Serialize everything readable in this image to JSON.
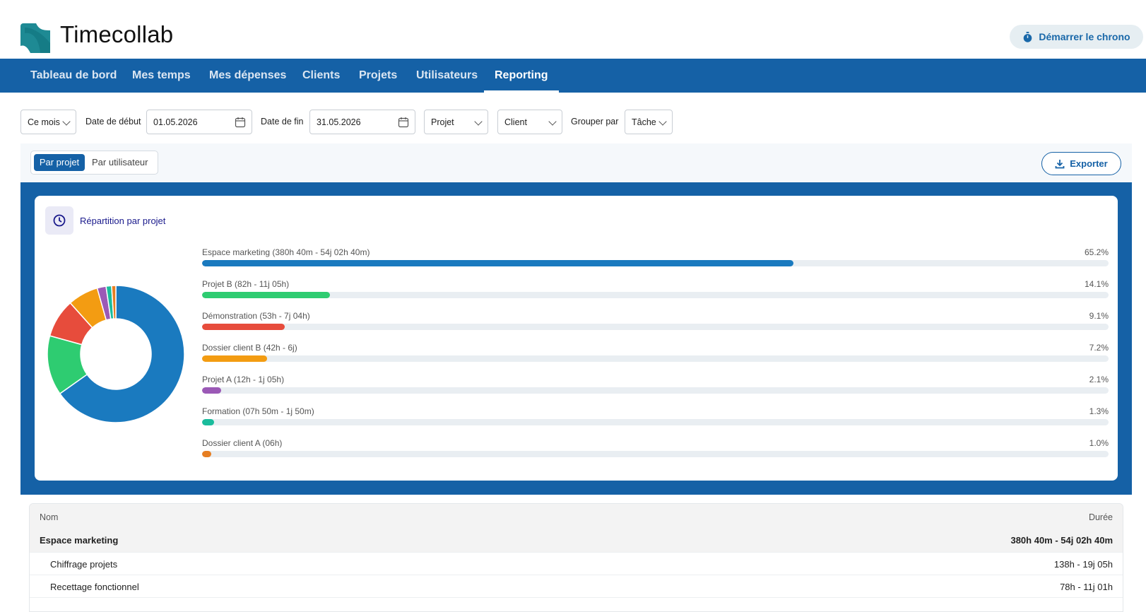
{
  "app": {
    "title": "Timecollab",
    "chrono_label": "Démarrer le chrono"
  },
  "nav": {
    "items": [
      {
        "label": "Tableau de bord"
      },
      {
        "label": "Mes temps"
      },
      {
        "label": "Mes dépenses"
      },
      {
        "label": "Clients"
      },
      {
        "label": "Projets"
      },
      {
        "label": "Utilisateurs"
      },
      {
        "label": "Reporting",
        "active": true
      }
    ]
  },
  "filters": {
    "period": "Ce mois",
    "start_label": "Date de début",
    "start_date": "01.05.2026",
    "end_label": "Date de fin",
    "end_date": "31.05.2026",
    "project": "Projet",
    "client": "Client",
    "group_label": "Grouper par",
    "group_value": "Tâche"
  },
  "view": {
    "by_project": "Par projet",
    "by_user": "Par utilisateur",
    "export_label": "Exporter"
  },
  "chart_card": {
    "title": "Répartition par projet"
  },
  "chart_data": {
    "type": "pie",
    "donut": true,
    "series": [
      {
        "label": "Espace marketing (380h 40m - 54j 02h 40m)",
        "pct_label": "65.2%",
        "value": 65.2,
        "color": "#1a7abf"
      },
      {
        "label": "Projet B (82h - 11j 05h)",
        "pct_label": "14.1%",
        "value": 14.1,
        "color": "#2ecc71"
      },
      {
        "label": "Démonstration (53h - 7j 04h)",
        "pct_label": "9.1%",
        "value": 9.1,
        "color": "#e74c3c"
      },
      {
        "label": "Dossier client B (42h - 6j)",
        "pct_label": "7.2%",
        "value": 7.2,
        "color": "#f39c12"
      },
      {
        "label": "Projet A (12h - 1j 05h)",
        "pct_label": "2.1%",
        "value": 2.1,
        "color": "#9b59b6"
      },
      {
        "label": "Formation (07h 50m - 1j 50m)",
        "pct_label": "1.3%",
        "value": 1.3,
        "color": "#1abc9c"
      },
      {
        "label": "Dossier client A (06h)",
        "pct_label": "1.0%",
        "value": 1.0,
        "color": "#e67e22"
      }
    ]
  },
  "table": {
    "col_name": "Nom",
    "col_duration": "Durée",
    "group": {
      "name": "Espace marketing",
      "duration": "380h 40m - 54j 02h 40m"
    },
    "rows": [
      {
        "name": "Chiffrage projets",
        "duration": "138h - 19j 05h"
      },
      {
        "name": "Recettage fonctionnel",
        "duration": "78h - 11j 01h"
      }
    ]
  }
}
